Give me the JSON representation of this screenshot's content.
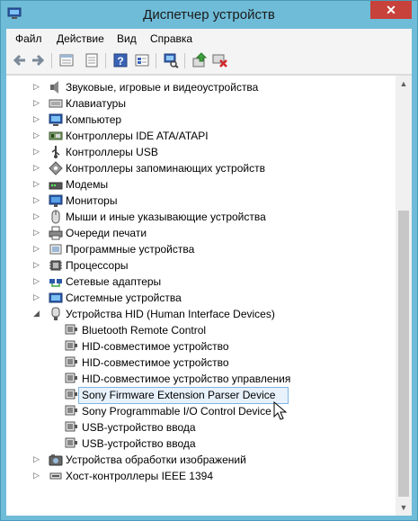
{
  "window": {
    "title": "Диспетчер устройств",
    "close_symbol": "✕"
  },
  "menu": [
    "Файл",
    "Действие",
    "Вид",
    "Справка"
  ],
  "toolbar_icons": [
    "back-icon",
    "forward-icon",
    "properties-icon",
    "show-hidden-icon",
    "help-icon",
    "view-icon",
    "scan-hardware-icon",
    "update-driver-icon",
    "uninstall-icon"
  ],
  "tree": [
    {
      "label": "Звуковые, игровые и видеоустройства",
      "level": 0,
      "expander": "collapsed",
      "icon": "speaker-icon"
    },
    {
      "label": "Клавиатуры",
      "level": 0,
      "expander": "collapsed",
      "icon": "keyboard-icon"
    },
    {
      "label": "Компьютер",
      "level": 0,
      "expander": "collapsed",
      "icon": "computer-icon"
    },
    {
      "label": "Контроллеры IDE ATA/ATAPI",
      "level": 0,
      "expander": "collapsed",
      "icon": "ide-controller-icon"
    },
    {
      "label": "Контроллеры USB",
      "level": 0,
      "expander": "collapsed",
      "icon": "usb-icon"
    },
    {
      "label": "Контроллеры запоминающих устройств",
      "level": 0,
      "expander": "collapsed",
      "icon": "storage-controller-icon"
    },
    {
      "label": "Модемы",
      "level": 0,
      "expander": "collapsed",
      "icon": "modem-icon"
    },
    {
      "label": "Мониторы",
      "level": 0,
      "expander": "collapsed",
      "icon": "monitor-icon"
    },
    {
      "label": "Мыши и иные указывающие устройства",
      "level": 0,
      "expander": "collapsed",
      "icon": "mouse-icon"
    },
    {
      "label": "Очереди печати",
      "level": 0,
      "expander": "collapsed",
      "icon": "printer-icon"
    },
    {
      "label": "Программные устройства",
      "level": 0,
      "expander": "collapsed",
      "icon": "software-device-icon"
    },
    {
      "label": "Процессоры",
      "level": 0,
      "expander": "collapsed",
      "icon": "processor-icon"
    },
    {
      "label": "Сетевые адаптеры",
      "level": 0,
      "expander": "collapsed",
      "icon": "network-adapter-icon"
    },
    {
      "label": "Системные устройства",
      "level": 0,
      "expander": "collapsed",
      "icon": "system-device-icon"
    },
    {
      "label": "Устройства HID (Human Interface Devices)",
      "level": 0,
      "expander": "expanded",
      "icon": "hid-icon"
    },
    {
      "label": "Bluetooth Remote Control",
      "level": 1,
      "expander": "none",
      "icon": "hid-device-icon"
    },
    {
      "label": "HID-совместимое устройство",
      "level": 1,
      "expander": "none",
      "icon": "hid-device-icon"
    },
    {
      "label": "HID-совместимое устройство",
      "level": 1,
      "expander": "none",
      "icon": "hid-device-icon"
    },
    {
      "label": "HID-совместимое устройство управления",
      "level": 1,
      "expander": "none",
      "icon": "hid-device-icon"
    },
    {
      "label": "Sony Firmware Extension Parser Device",
      "level": 1,
      "expander": "none",
      "icon": "hid-device-icon",
      "selected": true
    },
    {
      "label": "Sony Programmable I/O Control Device",
      "level": 1,
      "expander": "none",
      "icon": "hid-device-icon"
    },
    {
      "label": "USB-устройство ввода",
      "level": 1,
      "expander": "none",
      "icon": "hid-device-icon"
    },
    {
      "label": "USB-устройство ввода",
      "level": 1,
      "expander": "none",
      "icon": "hid-device-icon"
    },
    {
      "label": "Устройства обработки изображений",
      "level": 0,
      "expander": "collapsed",
      "icon": "imaging-device-icon"
    },
    {
      "label": "Хост-контроллеры IEEE 1394",
      "level": 0,
      "expander": "collapsed",
      "icon": "ieee1394-icon"
    }
  ],
  "scroll": {
    "up_symbol": "▲",
    "down_symbol": "▼"
  }
}
